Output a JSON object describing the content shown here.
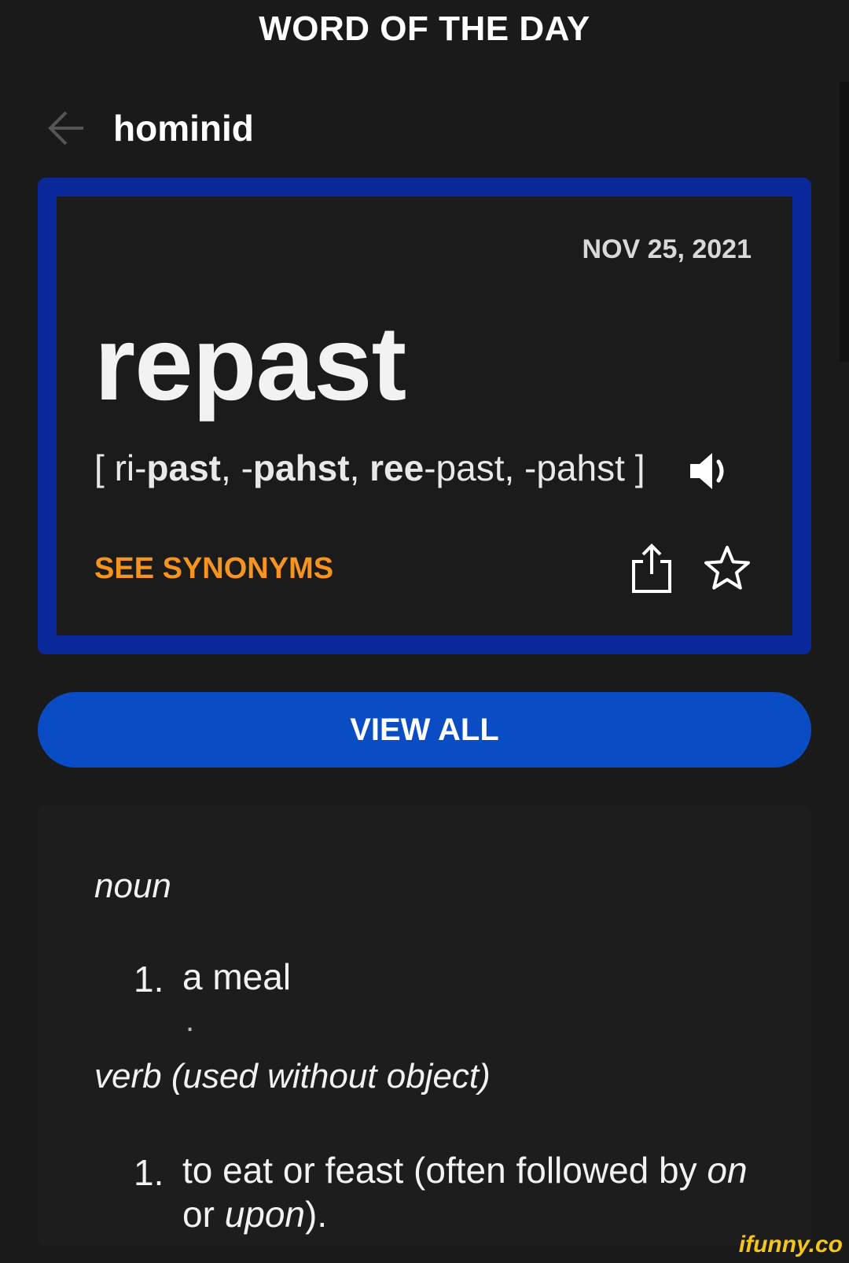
{
  "header": {
    "title": "WORD OF THE DAY"
  },
  "nav": {
    "title": "hominid",
    "back_icon": "arrow-left-icon"
  },
  "card": {
    "date": "NOV 25, 2021",
    "word": "repast",
    "pronunciation": {
      "open": "[ ",
      "p1_pre": "ri-",
      "p1_bold": "past",
      "sep1": ", -",
      "p2_bold": "pahst",
      "sep2": ", ",
      "p3_bold": "ree",
      "p3_post": "-past, -pahst ]"
    },
    "see_synonyms": "SEE SYNONYMS",
    "colors": {
      "border": "#0a289a",
      "synonyms": "#f7941d"
    }
  },
  "view_all": {
    "label": "VIEW ALL",
    "color": "#0a4cc4"
  },
  "definitions": {
    "noun": {
      "pos": "noun",
      "items": [
        {
          "num": "1.",
          "text": "a meal"
        }
      ],
      "trailing": "."
    },
    "verb": {
      "pos": "verb (used without object)",
      "items": [
        {
          "num": "1.",
          "text_pre": "to eat or feast (often followed by ",
          "em1": "on",
          "mid": " or ",
          "em2": "upon",
          "post": ")."
        }
      ]
    }
  },
  "watermark": "ifunny.co"
}
